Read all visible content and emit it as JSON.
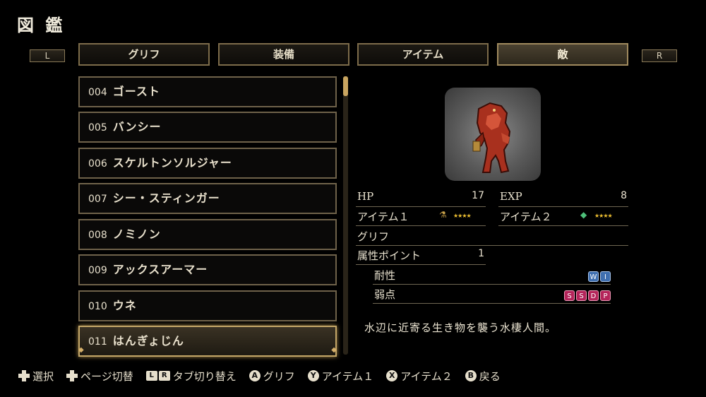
{
  "title": "図 鑑",
  "shoulders": {
    "left": "L",
    "right": "R"
  },
  "tabs": [
    {
      "label": "グリフ",
      "active": false
    },
    {
      "label": "装備",
      "active": false
    },
    {
      "label": "アイテム",
      "active": false
    },
    {
      "label": "敵",
      "active": true
    }
  ],
  "list": [
    {
      "num": "004",
      "name": "ゴースト"
    },
    {
      "num": "005",
      "name": "バンシー"
    },
    {
      "num": "006",
      "name": "スケルトンソルジャー"
    },
    {
      "num": "007",
      "name": "シー・スティンガー"
    },
    {
      "num": "008",
      "name": "ノミノン"
    },
    {
      "num": "009",
      "name": "アックスアーマー"
    },
    {
      "num": "010",
      "name": "ウネ"
    },
    {
      "num": "011",
      "name": "はんぎょじん",
      "selected": true
    }
  ],
  "detail": {
    "hp_label": "HP",
    "hp": "17",
    "exp_label": "EXP",
    "exp": "8",
    "item1_label": "アイテム１",
    "item1_stars": "★★★★",
    "item2_label": "アイテム２",
    "item2_stars": "★★★★",
    "glyph_label": "グリフ",
    "attr_points_label": "属性ポイント",
    "attr_points": "1",
    "resist_label": "耐性",
    "resist_badges": [
      "W",
      "I"
    ],
    "weak_label": "弱点",
    "weak_badges": [
      "S",
      "S",
      "D",
      "P"
    ],
    "description": "水辺に近寄る生き物を襲う水棲人間。"
  },
  "footer": {
    "select": "選択",
    "page_switch": "ページ切替",
    "tab_switch": "タブ切り替え",
    "a_label": "グリフ",
    "y_label": "アイテム１",
    "x_label": "アイテム２",
    "b_label": "戻る",
    "a_btn": "A",
    "y_btn": "Y",
    "x_btn": "X",
    "b_btn": "B",
    "l_btn": "L",
    "r_btn": "R"
  },
  "colors": {
    "accent": "#c4a768",
    "star": "#f1c232",
    "resist": "#3f6fb0",
    "weak": "#b4245a"
  }
}
